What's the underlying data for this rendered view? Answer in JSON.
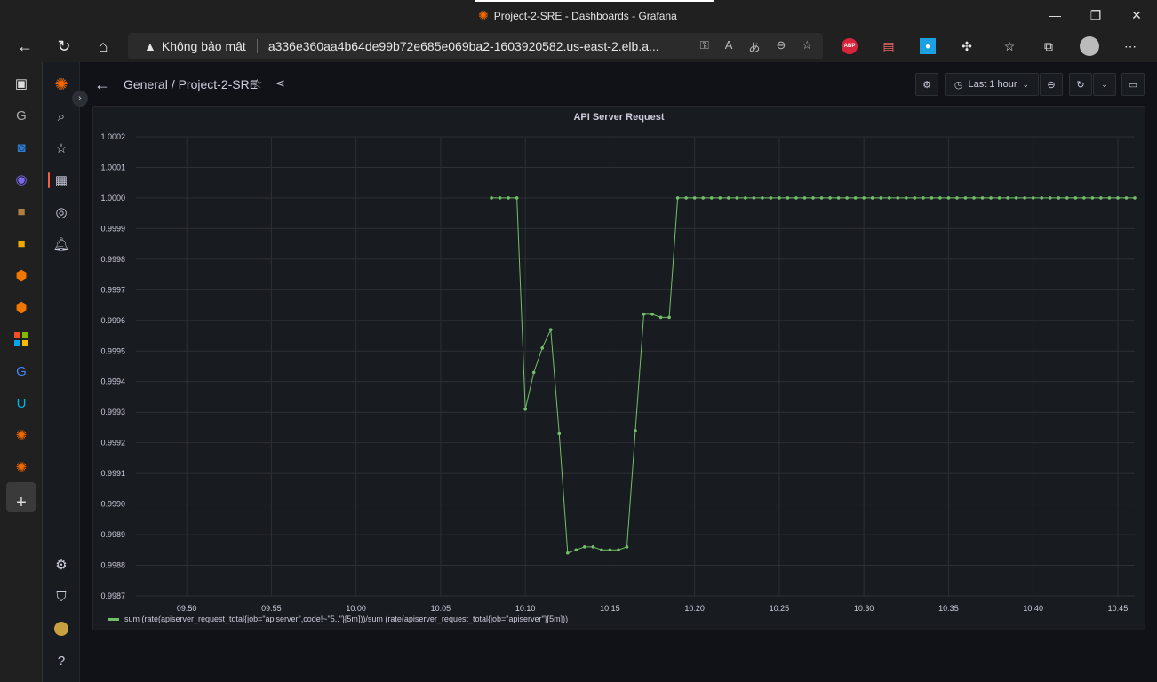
{
  "window": {
    "title": "Project-2-SRE - Dashboards - Grafana",
    "controls": {
      "minimize": "—",
      "maximize": "❐",
      "close": "✕"
    }
  },
  "addressbar": {
    "security_label": "Không bảo mật",
    "url": "a336e360aa4b64de99b72e685e069ba2-1603920582.us-east-2.elb.a...",
    "extensions": {
      "abp": "ABP"
    }
  },
  "grafana": {
    "breadcrumb_folder": "General",
    "breadcrumb_dashboard": "/ Project-2-SRE",
    "time_range": "Last 1 hour"
  },
  "panel": {
    "title": "API Server Request",
    "legend": "sum (rate(apiserver_request_total{job=\"apiserver\",code!~\"5..\"}[5m]))/sum (rate(apiserver_request_total{job=\"apiserver\"}[5m]))",
    "series_color": "#73bf69"
  },
  "chart_data": {
    "type": "line",
    "title": "API Server Request",
    "xlabel": "",
    "ylabel": "",
    "grid": true,
    "legend_placement": "bottom-left",
    "ylim": [
      0.9987,
      1.0002
    ],
    "xlim": [
      "09:47",
      "10:46"
    ],
    "y_ticks": [
      "1.0002",
      "1.0001",
      "1.0000",
      "0.9999",
      "0.9998",
      "0.9997",
      "0.9996",
      "0.9995",
      "0.9994",
      "0.9993",
      "0.9992",
      "0.9991",
      "0.9990",
      "0.9989",
      "0.9988",
      "0.9987"
    ],
    "x_ticks": [
      "09:50",
      "09:55",
      "10:00",
      "10:05",
      "10:10",
      "10:15",
      "10:20",
      "10:25",
      "10:30",
      "10:35",
      "10:40",
      "10:45"
    ],
    "series": [
      {
        "name": "sum (rate(apiserver_request_total{job=\"apiserver\",code!~\"5..\"}[5m]))/sum (rate(apiserver_request_total{job=\"apiserver\"}[5m]))",
        "x": [
          "10:08:00",
          "10:08:30",
          "10:09:00",
          "10:09:30",
          "10:10:00",
          "10:10:30",
          "10:11:00",
          "10:11:30",
          "10:12:00",
          "10:12:30",
          "10:13:00",
          "10:13:30",
          "10:14:00",
          "10:14:30",
          "10:15:00",
          "10:15:30",
          "10:16:00",
          "10:16:30",
          "10:17:00",
          "10:17:30",
          "10:18:00",
          "10:18:30",
          "10:19:00",
          "10:19:30",
          "10:20:00",
          "10:20:30",
          "10:21:00",
          "10:21:30",
          "10:22:00",
          "10:22:30",
          "10:23:00",
          "10:23:30",
          "10:24:00",
          "10:24:30",
          "10:25:00",
          "10:25:30",
          "10:26:00",
          "10:26:30",
          "10:27:00",
          "10:27:30",
          "10:28:00",
          "10:28:30",
          "10:29:00",
          "10:29:30",
          "10:30:00",
          "10:30:30",
          "10:31:00",
          "10:31:30",
          "10:32:00",
          "10:32:30",
          "10:33:00",
          "10:33:30",
          "10:34:00",
          "10:34:30",
          "10:35:00",
          "10:35:30",
          "10:36:00",
          "10:36:30",
          "10:37:00",
          "10:37:30",
          "10:38:00",
          "10:38:30",
          "10:39:00",
          "10:39:30",
          "10:40:00",
          "10:40:30",
          "10:41:00",
          "10:41:30",
          "10:42:00",
          "10:42:30",
          "10:43:00",
          "10:43:30",
          "10:44:00",
          "10:44:30",
          "10:45:00",
          "10:45:30",
          "10:46:00"
        ],
        "y": [
          1.0,
          1.0,
          1.0,
          1.0,
          0.99931,
          0.99943,
          0.99951,
          0.99957,
          0.99923,
          0.99884,
          0.99885,
          0.99886,
          0.99886,
          0.99885,
          0.99885,
          0.99885,
          0.99886,
          0.99924,
          0.99962,
          0.99962,
          0.99961,
          0.99961,
          1.0,
          1.0,
          1.0,
          1.0,
          1.0,
          1.0,
          1.0,
          1.0,
          1.0,
          1.0,
          1.0,
          1.0,
          1.0,
          1.0,
          1.0,
          1.0,
          1.0,
          1.0,
          1.0,
          1.0,
          1.0,
          1.0,
          1.0,
          1.0,
          1.0,
          1.0,
          1.0,
          1.0,
          1.0,
          1.0,
          1.0,
          1.0,
          1.0,
          1.0,
          1.0,
          1.0,
          1.0,
          1.0,
          1.0,
          1.0,
          1.0,
          1.0,
          1.0,
          1.0,
          1.0,
          1.0,
          1.0,
          1.0,
          1.0,
          1.0,
          1.0,
          1.0,
          1.0,
          1.0,
          1.0
        ]
      }
    ]
  }
}
